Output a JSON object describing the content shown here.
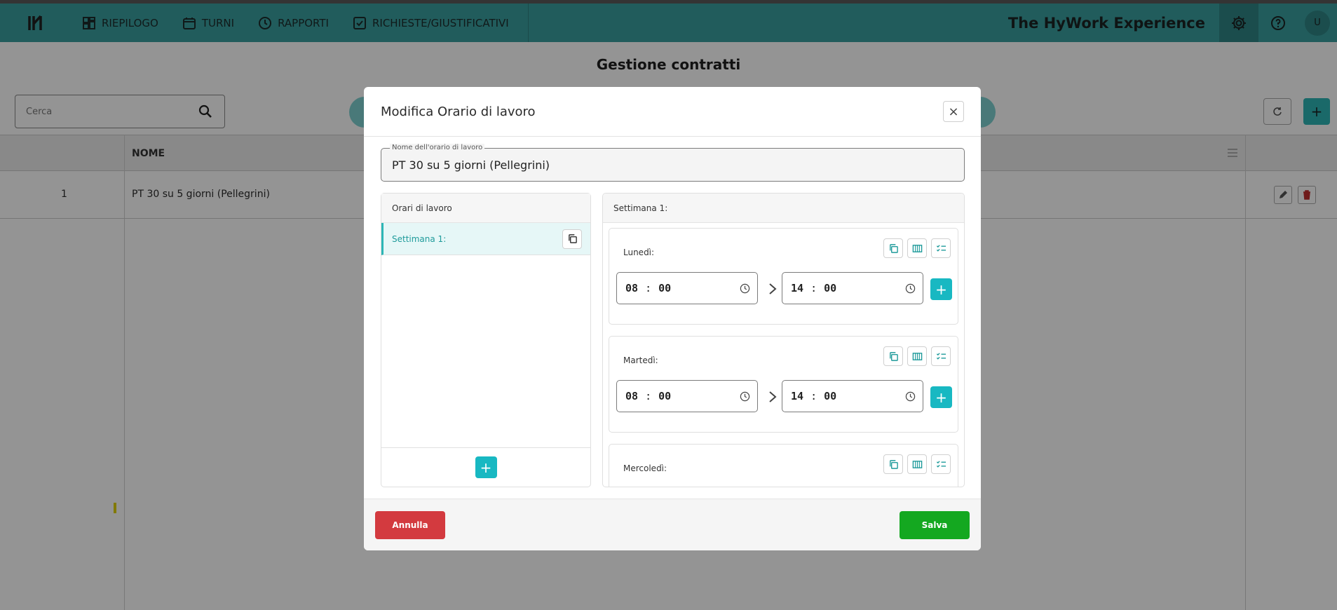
{
  "topbar": {
    "logo": "ꓘ",
    "nav": [
      {
        "label": "RIEPILOGO",
        "icon": "dashboard-icon"
      },
      {
        "label": "TURNI",
        "icon": "calendar-icon"
      },
      {
        "label": "RAPPORTI",
        "icon": "clock-icon"
      },
      {
        "label": "RICHIESTE/GIUSTIFICATIVI",
        "icon": "checkbox-icon"
      }
    ],
    "brand": "The HyWork Experience",
    "avatar": "U"
  },
  "page": {
    "title": "Gestione contratti",
    "search_placeholder": "Cerca",
    "table": {
      "columns": [
        "NOME"
      ],
      "rows": [
        {
          "id": "1",
          "name": "PT 30 su 5 giorni (Pellegrini)"
        }
      ]
    }
  },
  "modal": {
    "title": "Modifica Orario di lavoro",
    "name_label": "Nome dell'orario di lavoro",
    "name_value": "PT 30 su 5 giorni (Pellegrini)",
    "left_header": "Orari di lavoro",
    "weeks": [
      "Settimana 1:"
    ],
    "right_header": "Settimana 1:",
    "days": [
      {
        "label": "Lunedì:",
        "start_h": "08",
        "start_m": "00",
        "end_h": "14",
        "end_m": "00"
      },
      {
        "label": "Martedì:",
        "start_h": "08",
        "start_m": "00",
        "end_h": "14",
        "end_m": "00"
      },
      {
        "label": "Mercoledì:",
        "start_h": "",
        "start_m": "",
        "end_h": "",
        "end_m": ""
      }
    ],
    "cancel_label": "Annulla",
    "save_label": "Salva"
  },
  "colors": {
    "topbar": "#3a9f9f",
    "accent": "#18b8c2",
    "cancel": "#d33a3f",
    "save": "#14a820"
  }
}
